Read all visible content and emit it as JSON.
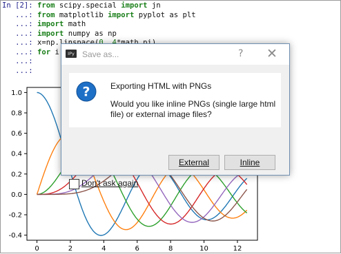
{
  "code_cell": {
    "prompt_first": "In [2]:",
    "prompt_cont": "...:",
    "lines": [
      [
        {
          "t": "from ",
          "c": "kw"
        },
        {
          "t": "scipy.special ",
          "c": "plain"
        },
        {
          "t": "import ",
          "c": "kw"
        },
        {
          "t": "jn",
          "c": "plain"
        }
      ],
      [
        {
          "t": "from ",
          "c": "kw"
        },
        {
          "t": "matplotlib ",
          "c": "plain"
        },
        {
          "t": "import ",
          "c": "kw"
        },
        {
          "t": "pyplot as plt",
          "c": "plain"
        }
      ],
      [
        {
          "t": "import ",
          "c": "kw"
        },
        {
          "t": "math",
          "c": "plain"
        }
      ],
      [
        {
          "t": "import ",
          "c": "kw"
        },
        {
          "t": "numpy as np",
          "c": "plain"
        }
      ],
      [
        {
          "t": "x=np.linspace(",
          "c": "plain"
        },
        {
          "t": "0",
          "c": "num"
        },
        {
          "t": ", ",
          "c": "plain"
        },
        {
          "t": "4",
          "c": "num"
        },
        {
          "t": "*math.pi)",
          "c": "plain"
        }
      ],
      [
        {
          "t": "for ",
          "c": "kw"
        },
        {
          "t": "i ",
          "c": "plain"
        },
        {
          "t": "i",
          "c": "kw"
        }
      ],
      [],
      []
    ]
  },
  "chart_data": {
    "type": "line",
    "title": "",
    "xlabel": "",
    "ylabel": "",
    "xlim": [
      -0.6,
      13.2
    ],
    "ylim": [
      -0.45,
      1.05
    ],
    "x_ticks": [
      "0",
      "2",
      "4",
      "6",
      "8",
      "10",
      "12"
    ],
    "y_ticks": [
      "1.0",
      "0.8",
      "0.6",
      "0.4",
      "0.2",
      "0.0",
      "-0.2",
      "-0.4"
    ],
    "series": [
      {
        "order": 0,
        "color": "#1f77b4"
      },
      {
        "order": 1,
        "color": "#ff7f0e"
      },
      {
        "order": 2,
        "color": "#2ca02c"
      },
      {
        "order": 3,
        "color": "#d62728"
      },
      {
        "order": 4,
        "color": "#9467bd"
      },
      {
        "order": 5,
        "color": "#8c564b"
      }
    ]
  },
  "dialog": {
    "app_icon": "IPy",
    "title": "Save as...",
    "help": "?",
    "close": "✕",
    "heading": "Exporting HTML with PNGs",
    "message": "Would you like inline PNGs (single large html file) or external image files?",
    "buttons": {
      "external": "External",
      "inline": "Inline"
    },
    "checkbox_label": "Don't ask again",
    "checkbox_checked": false,
    "accent": "#1e6fc6"
  }
}
